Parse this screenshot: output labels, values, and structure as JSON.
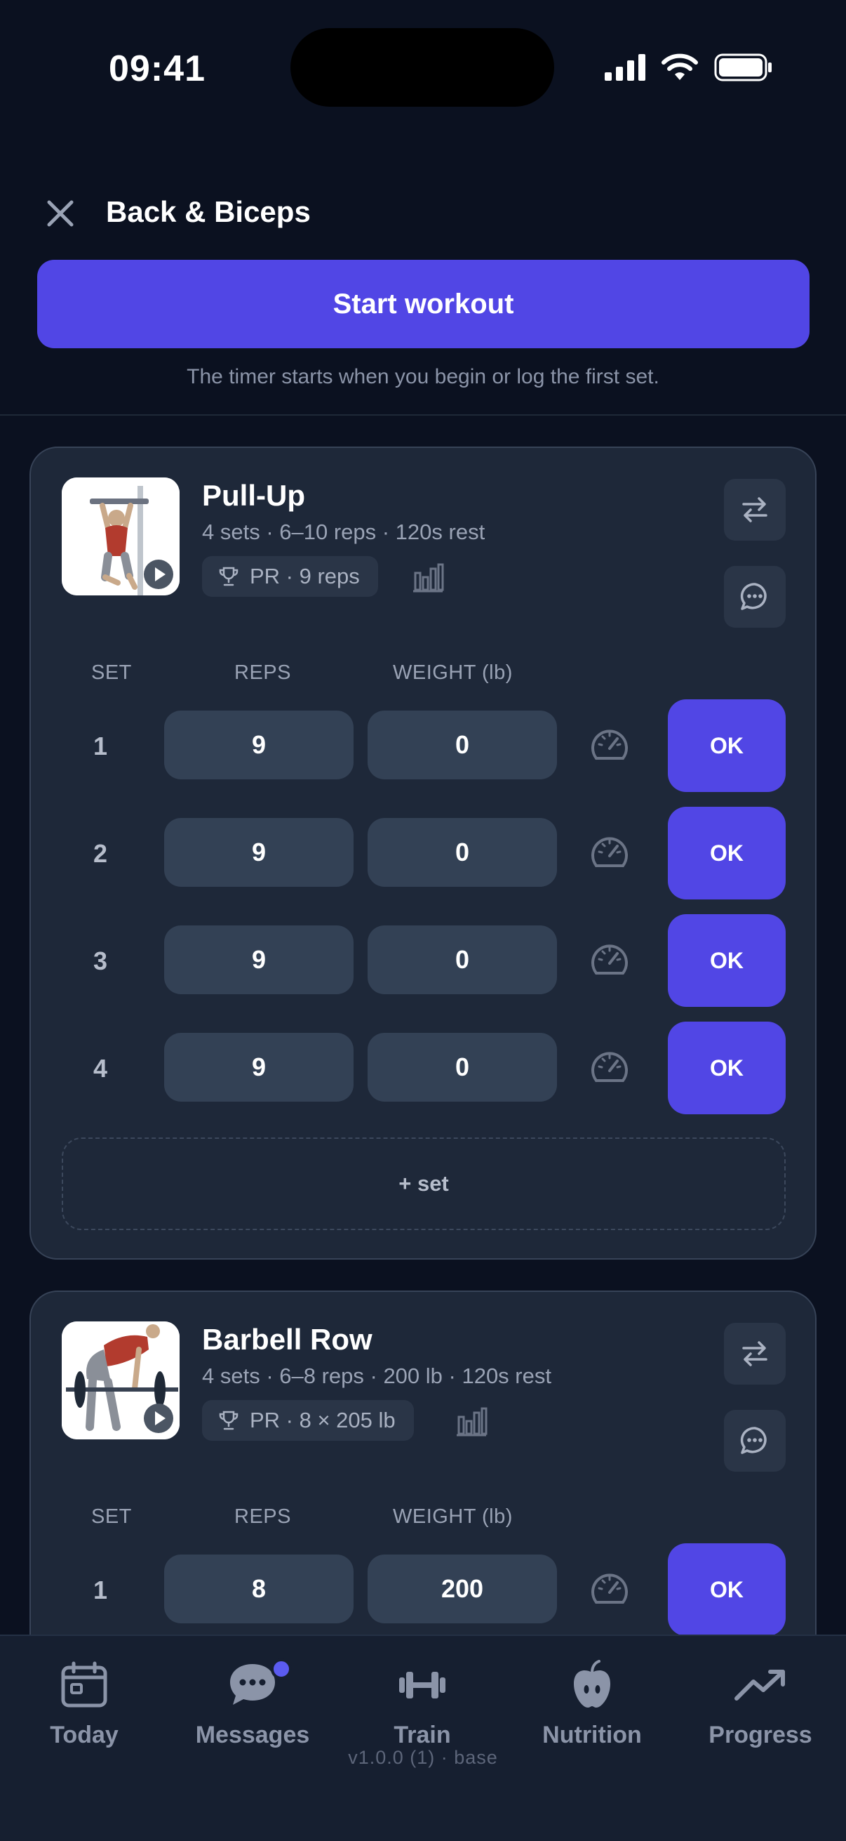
{
  "status_bar": {
    "time": "09:41"
  },
  "header": {
    "title": "Back & Biceps",
    "start_label": "Start workout",
    "hint": "The timer starts when you begin or log the first set."
  },
  "exercises": [
    {
      "name": "Pull-Up",
      "meta": "4 sets · 6–10 reps · 120s rest",
      "pr": "PR · 9 reps",
      "columns": {
        "set": "SET",
        "reps": "REPS",
        "weight": "WEIGHT (lb)"
      },
      "sets": [
        {
          "num": "1",
          "reps": "9",
          "weight": "0",
          "action": "OK"
        },
        {
          "num": "2",
          "reps": "9",
          "weight": "0",
          "action": "OK"
        },
        {
          "num": "3",
          "reps": "9",
          "weight": "0",
          "action": "OK"
        },
        {
          "num": "4",
          "reps": "9",
          "weight": "0",
          "action": "OK"
        }
      ],
      "add_set_label": "+ set"
    },
    {
      "name": "Barbell Row",
      "meta": "4 sets · 6–8 reps · 200 lb · 120s rest",
      "pr": "PR · 8 × 205 lb",
      "columns": {
        "set": "SET",
        "reps": "REPS",
        "weight": "WEIGHT (lb)"
      },
      "sets": [
        {
          "num": "1",
          "reps": "8",
          "weight": "200",
          "action": "OK"
        }
      ]
    }
  ],
  "nav": {
    "items": [
      {
        "label": "Today",
        "icon": "calendar-icon"
      },
      {
        "label": "Messages",
        "icon": "chat-icon"
      },
      {
        "label": "Train",
        "icon": "dumbbell-icon"
      },
      {
        "label": "Nutrition",
        "icon": "apple-icon"
      },
      {
        "label": "Progress",
        "icon": "trending-up-icon"
      }
    ]
  },
  "version": "v1.0.0 (1) · base",
  "colors": {
    "accent": "#5146e5",
    "background": "#0b1120",
    "card": "#1e2839",
    "field": "#334155",
    "badge": "#5b5bf0"
  }
}
